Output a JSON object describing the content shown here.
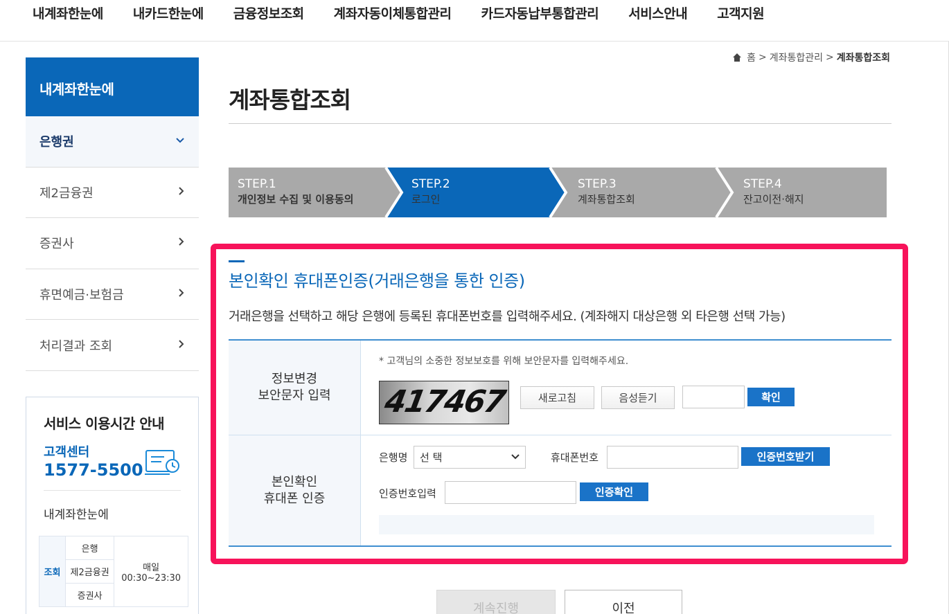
{
  "topnav": [
    "내계좌한눈에",
    "내카드한눈에",
    "금융정보조회",
    "계좌자동이체통합관리",
    "카드자동납부통합관리",
    "서비스안내",
    "고객지원"
  ],
  "sidebar": {
    "title": "내계좌한눈에",
    "items": [
      {
        "label": "은행권",
        "active": true
      },
      {
        "label": "제2금융권"
      },
      {
        "label": "증권사"
      },
      {
        "label": "휴면예금·보험금"
      },
      {
        "label": "처리결과 조회"
      }
    ],
    "service": {
      "title": "서비스 이용시간 안내",
      "cc_label": "고객센터",
      "cc_phone": "1577-5500",
      "sub": "내계좌한눈에",
      "table": {
        "head": "조회",
        "rows": [
          "은행",
          "제2금융권",
          "증권사"
        ],
        "time_label": "매일",
        "time": "00:30~23:30"
      }
    }
  },
  "breadcrumb": {
    "home": "홈",
    "mid": "계좌통합관리",
    "current": "계좌통합조회"
  },
  "page_title": "계좌통합조회",
  "steps": [
    {
      "num": "STEP.1",
      "label": "개인정보 수집 및 이용동의",
      "state": "done"
    },
    {
      "num": "STEP.2",
      "label": "로그인",
      "state": "active"
    },
    {
      "num": "STEP.3",
      "label": "계좌통합조회",
      "state": "todo"
    },
    {
      "num": "STEP.4",
      "label": "잔고이전·해지",
      "state": "todo"
    }
  ],
  "section": {
    "title": "본인확인 휴대폰인증(거래은행을 통한 인증)",
    "desc": "거래은행을 선택하고 해당 은행에 등록된 휴대폰번호를 입력해주세요. (계좌해지 대상은행 외 타은행 선택 가능)"
  },
  "captcha": {
    "head_line1": "정보변경",
    "head_line2": "보안문자 입력",
    "note": "* 고객님의 소중한 정보보호를 위해 보안문자를 입력해주세요.",
    "image_text": "417467",
    "refresh": "새로고침",
    "audio": "음성듣기",
    "confirm": "확인"
  },
  "phone_auth": {
    "head_line1": "본인확인",
    "head_line2": "휴대폰 인증",
    "bank_label": "은행명",
    "bank_value": "선 택",
    "phone_label": "휴대폰번호",
    "get_code": "인증번호받기",
    "code_label": "인증번호입력",
    "verify": "인증확인"
  },
  "buttons": {
    "next": "계속진행",
    "prev": "이전"
  },
  "colors": {
    "brand_blue": "#0a67b8",
    "highlight": "#f7135a",
    "step_inactive": "#a9a9a9"
  }
}
